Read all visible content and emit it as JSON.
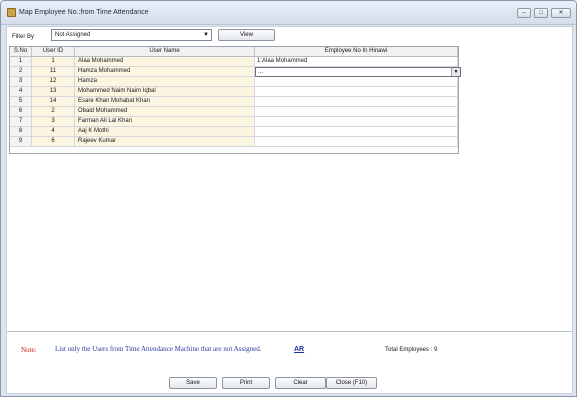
{
  "window": {
    "title": "Map Employee No.:from Time Attendance",
    "min_glyph": "–",
    "max_glyph": "□",
    "close_glyph": "✕"
  },
  "filter": {
    "label": "Filter By",
    "selected": "Not Assigned",
    "arrow_glyph": "▼",
    "view_label": "View"
  },
  "grid": {
    "headers": [
      "S.No",
      "User ID",
      "User Name",
      "Employee No In Hinawi"
    ],
    "rows": [
      {
        "sno": "1",
        "user_id": "1",
        "user_name": "Alaa Mohammed",
        "employee_no": "1:Alaa Mohammed"
      },
      {
        "sno": "2",
        "user_id": "11",
        "user_name": "Hamza Mohammed",
        "employee_no": "..."
      },
      {
        "sno": "3",
        "user_id": "12",
        "user_name": "Hamza",
        "employee_no": ""
      },
      {
        "sno": "4",
        "user_id": "13",
        "user_name": "Mohammed Naim Naim Iqbal",
        "employee_no": ""
      },
      {
        "sno": "5",
        "user_id": "14",
        "user_name": "Esare Khan Mohabat Khan",
        "employee_no": ""
      },
      {
        "sno": "6",
        "user_id": "2",
        "user_name": "Obaid Mohammed",
        "employee_no": ""
      },
      {
        "sno": "7",
        "user_id": "3",
        "user_name": "Farman Ali Lal Khan",
        "employee_no": ""
      },
      {
        "sno": "8",
        "user_id": "4",
        "user_name": "Aaj K Mothi",
        "employee_no": ""
      },
      {
        "sno": "9",
        "user_id": "6",
        "user_name": "Rajeev Kumar",
        "employee_no": ""
      }
    ],
    "dropdown_glyph": "▼"
  },
  "footer": {
    "note_label": "Note:",
    "note_text": "List only the Users from Time Attendance Machine that are not Assigned.",
    "ar_link": "AR",
    "total_label": "Total Employees : 9"
  },
  "buttons": {
    "save": "Save",
    "print": "Print",
    "clear": "Clear",
    "close": "Close (F10)"
  }
}
